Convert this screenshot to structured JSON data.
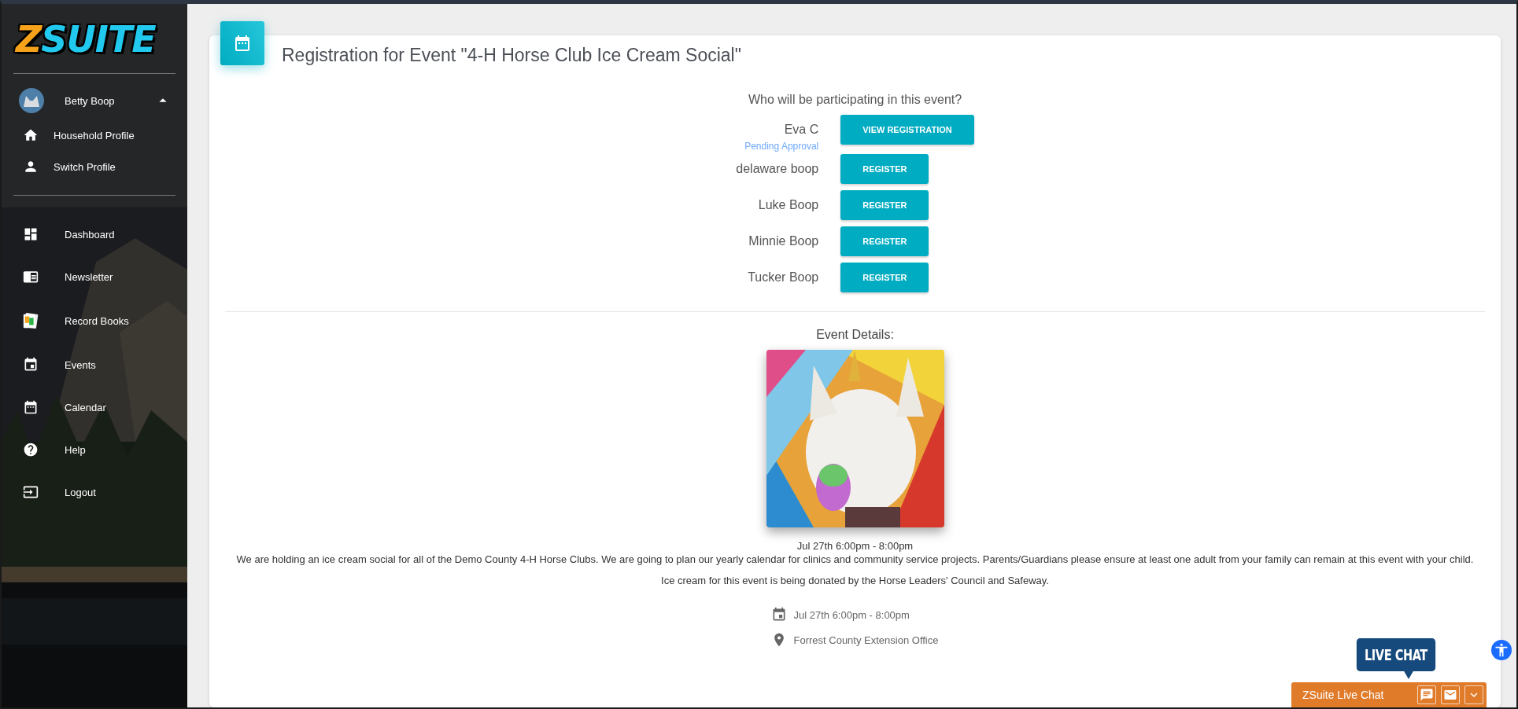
{
  "brand": {
    "logo": "ZSUITE"
  },
  "user": {
    "name": "Betty Boop",
    "expanded": true
  },
  "profile_menu": [
    {
      "label": "Household Profile",
      "kind": "home"
    },
    {
      "label": "Switch Profile",
      "kind": "person"
    }
  ],
  "nav": [
    {
      "label": "Dashboard",
      "kind": "dashboard"
    },
    {
      "label": "Newsletter",
      "kind": "newsletter"
    },
    {
      "label": "Record Books",
      "kind": "recordbook"
    },
    {
      "label": "Events",
      "kind": "event"
    },
    {
      "label": "Calendar",
      "kind": "calendar"
    },
    {
      "label": "Help",
      "kind": "help"
    },
    {
      "label": "Logout",
      "kind": "logout"
    }
  ],
  "page": {
    "title": "Registration for Event \"4-H Horse Club Ice Cream Social\""
  },
  "participants": {
    "question": "Who will be participating in this event?",
    "people": [
      {
        "name": "Eva C",
        "action": "VIEW REGISTRATION",
        "status": "Pending Approval"
      },
      {
        "name": "delaware boop",
        "action": "REGISTER"
      },
      {
        "name": "Luke Boop",
        "action": "REGISTER"
      },
      {
        "name": "Minnie Boop",
        "action": "REGISTER"
      },
      {
        "name": "Tucker Boop",
        "action": "REGISTER"
      }
    ]
  },
  "event": {
    "heading": "Event Details:",
    "date": "Jul 27th 6:00pm - 8:00pm",
    "description": "We are holding an ice cream social for all of the Demo County 4-H Horse Clubs. We are going to plan our yearly calendar for clinics and community service projects. Parents/Guardians please ensure at least one adult from your family can remain at this event with your child.",
    "note": "Ice cream for this event is being donated by the Horse Leaders' Council and Safeway.",
    "info": [
      {
        "kind": "date",
        "text": "Jul 27th 6:00pm - 8:00pm"
      },
      {
        "kind": "location",
        "text": "Forrest County Extension Office"
      }
    ]
  },
  "chat": {
    "bubble": "LIVE CHAT",
    "title": "ZSuite Live Chat"
  }
}
